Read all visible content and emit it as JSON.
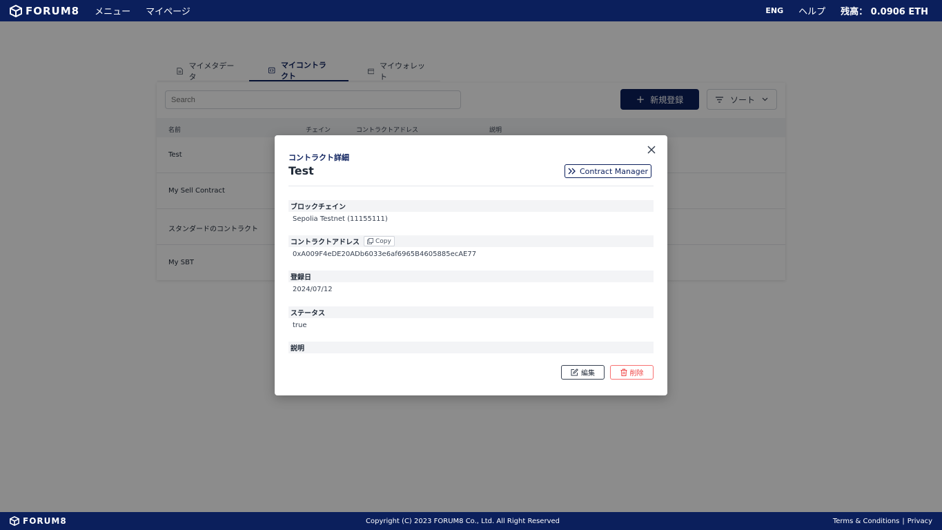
{
  "header": {
    "logo": "FORUM8",
    "nav": [
      "メニュー",
      "マイページ"
    ],
    "lang": "ENG",
    "help": "ヘルプ",
    "balance_label": "残高：",
    "balance_value": "0.0906 ETH"
  },
  "tabs": [
    {
      "label": "マイメタデータ",
      "icon": "document-icon"
    },
    {
      "label": "マイコントラクト",
      "icon": "code-icon"
    },
    {
      "label": "マイウォレット",
      "icon": "wallet-icon"
    }
  ],
  "toolbar": {
    "search_placeholder": "Search",
    "new_label": "新規登録",
    "sort_label": "ソート"
  },
  "table": {
    "columns": [
      "名前",
      "チェイン",
      "コントラクトアドレス",
      "説明"
    ],
    "rows": [
      "Test",
      "My Sell Contract",
      "スタンダードのコントラクト",
      "My SBT"
    ]
  },
  "modal": {
    "subtitle": "コントラクト詳細",
    "title": "Test",
    "manager_label": "Contract Manager",
    "fields": [
      {
        "label": "ブロックチェイン",
        "value": "Sepolia Testnet (11155111)"
      },
      {
        "label": "コントラクトアドレス",
        "value": "0xA009F4eDE20ADb6033e6af6965B4605885ecAE77",
        "copy_label": "Copy"
      },
      {
        "label": "登録日",
        "value": "2024/07/12"
      },
      {
        "label": "ステータス",
        "value": "true"
      },
      {
        "label": "説明",
        "value": ""
      }
    ],
    "edit_label": "編集",
    "delete_label": "削除"
  },
  "footer": {
    "logo": "FORUM8",
    "copyright": "Copyright (C) 2023 FORUM8 Co., Ltd. All Right Reserved",
    "terms": "Terms & Conditions",
    "separator": "|",
    "privacy": "Privacy"
  },
  "colors": {
    "brand": "#0b1f5c",
    "danger": "#ef4444"
  }
}
